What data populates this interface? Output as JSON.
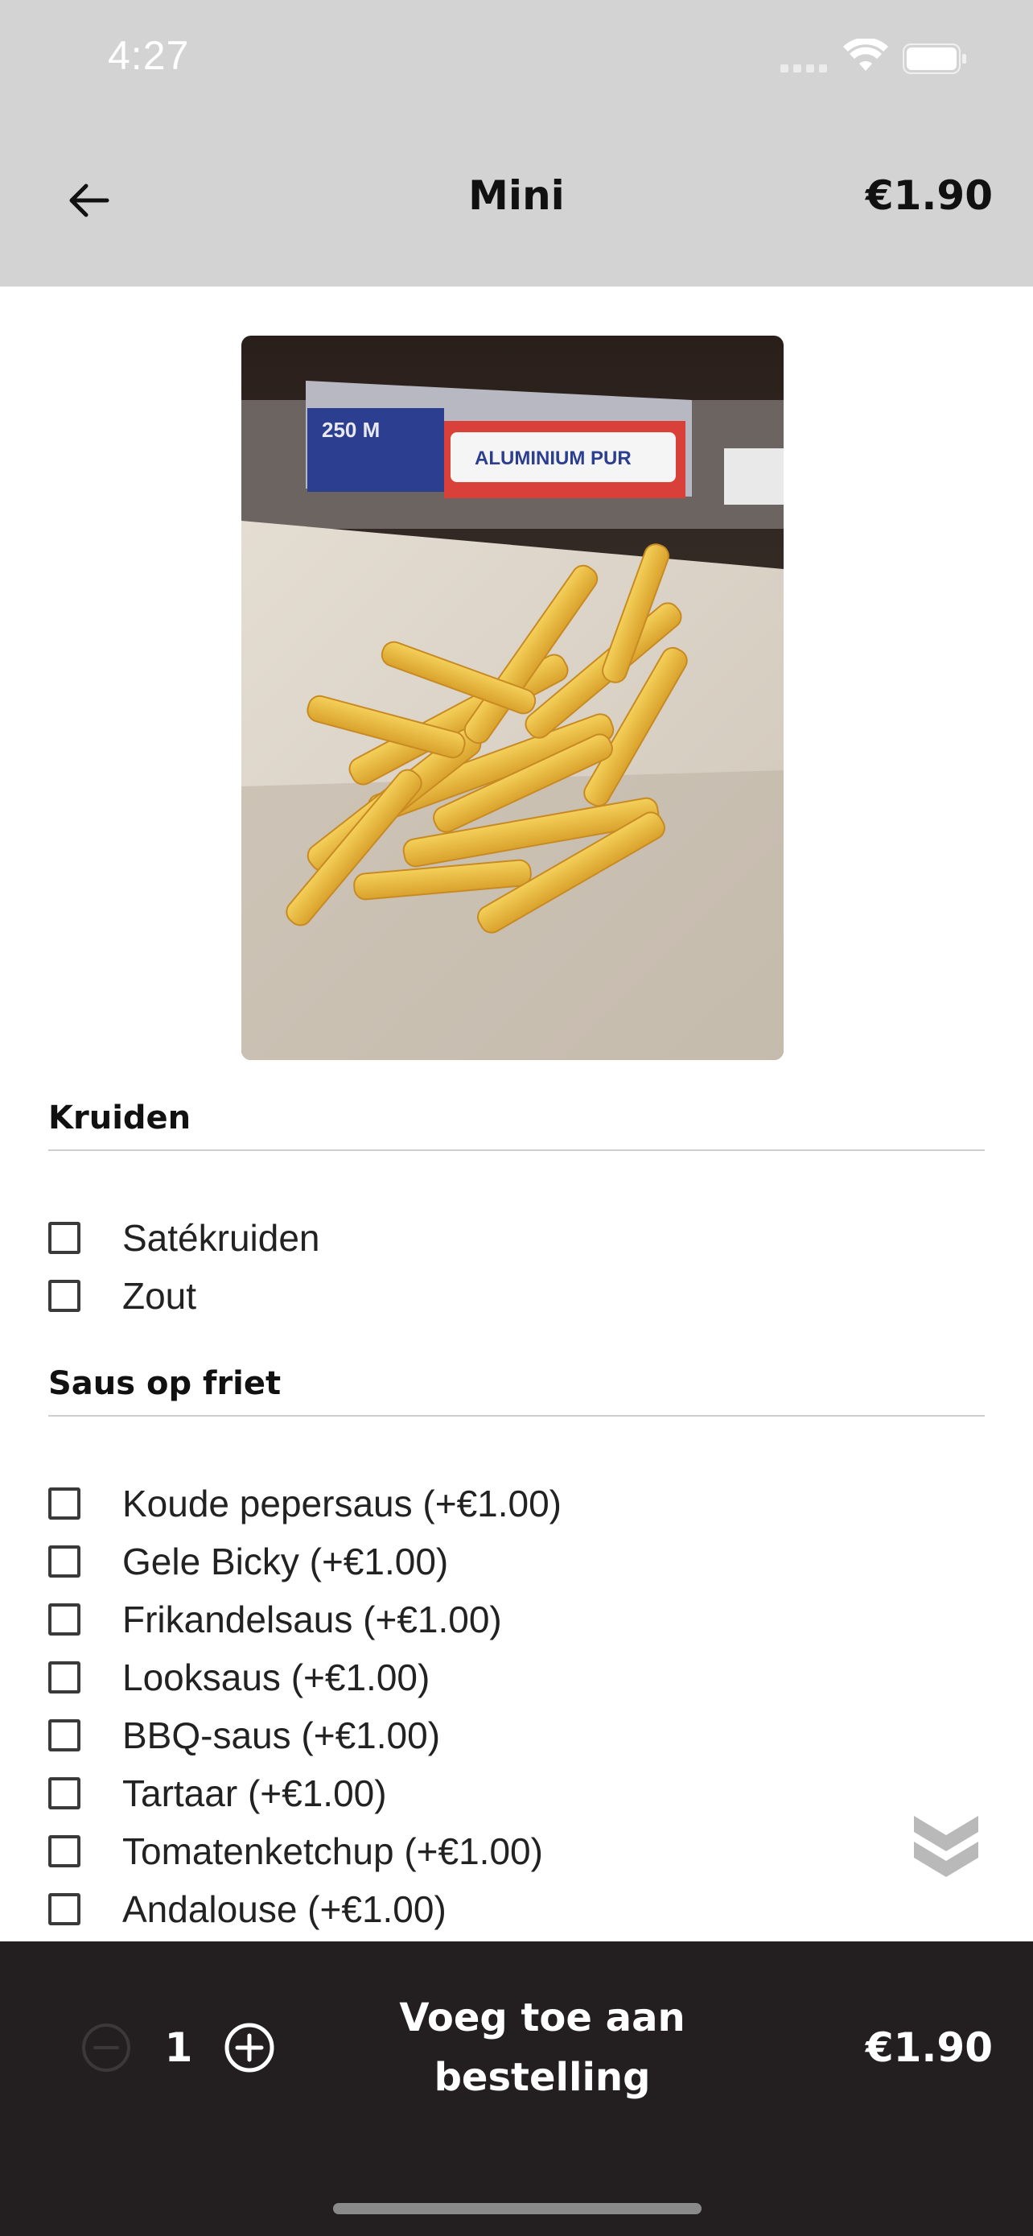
{
  "status_bar": {
    "time": "4:27",
    "icons": [
      "cellular-signal-icon",
      "wifi-icon",
      "battery-icon"
    ]
  },
  "header": {
    "back_icon": "arrow-left-icon",
    "title": "Mini",
    "price": "€1.90"
  },
  "product_image": {
    "subject": "fries-photo",
    "package_text": "ALUMINIUM PUR",
    "package_size": "250 M"
  },
  "sections": [
    {
      "title": "Kruiden",
      "options": [
        {
          "label": "Satékruiden",
          "checked": false
        },
        {
          "label": "Zout",
          "checked": false
        }
      ]
    },
    {
      "title": "Saus op friet",
      "options": [
        {
          "label": "Koude pepersaus (+€1.00)",
          "checked": false
        },
        {
          "label": "Gele Bicky (+€1.00)",
          "checked": false
        },
        {
          "label": "Frikandelsaus (+€1.00)",
          "checked": false
        },
        {
          "label": "Looksaus (+€1.00)",
          "checked": false
        },
        {
          "label": "BBQ-saus (+€1.00)",
          "checked": false
        },
        {
          "label": "Tartaar (+€1.00)",
          "checked": false
        },
        {
          "label": "Tomatenketchup (+€1.00)",
          "checked": false
        },
        {
          "label": "Andalouse (+€1.00)",
          "checked": false
        }
      ]
    }
  ],
  "scroll_hint_icon": "double-chevron-down-icon",
  "bottom_bar": {
    "quantity": "1",
    "minus_icon": "minus-circle-icon",
    "plus_icon": "plus-circle-icon",
    "add_button_line1": "Voeg toe aan",
    "add_button_line2": "bestelling",
    "total_price": "€1.90"
  },
  "colors": {
    "header_bg": "#d3d3d3",
    "bottom_bar_bg": "#231f20",
    "text": "#111111",
    "checkbox_border": "#3a3a3a",
    "scroll_hint": "#b9b9b9"
  }
}
